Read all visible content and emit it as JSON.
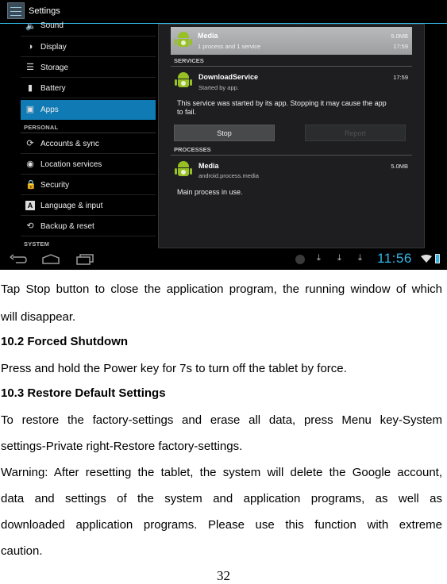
{
  "screenshot": {
    "app_title": "Settings",
    "accent_color": "#33b5e5",
    "sidebar": {
      "items_top": [
        {
          "label": "Sound",
          "icon": "sound-icon"
        },
        {
          "label": "Display",
          "icon": "display-icon"
        },
        {
          "label": "Storage",
          "icon": "storage-icon"
        },
        {
          "label": "Battery",
          "icon": "battery-icon"
        },
        {
          "label": "Apps",
          "icon": "apps-icon",
          "active": true
        }
      ],
      "section_personal": "PERSONAL",
      "items_personal": [
        {
          "label": "Accounts & sync",
          "icon": "sync-icon"
        },
        {
          "label": "Location services",
          "icon": "location-icon"
        },
        {
          "label": "Security",
          "icon": "lock-icon"
        },
        {
          "label": "Language & input",
          "icon": "language-icon"
        },
        {
          "label": "Backup & reset",
          "icon": "backup-icon"
        }
      ],
      "section_system": "SYSTEM"
    },
    "panel": {
      "app_row": {
        "title": "Media",
        "subtitle": "1 process and 1 service",
        "size": "5.0MB",
        "time": "17:59"
      },
      "services_label": "SERVICES",
      "service": {
        "title": "DownloadService",
        "subtitle": "Started by app.",
        "time": "17:59"
      },
      "service_desc_line1": "This service was started by its app. Stopping it may cause the app",
      "service_desc_line2": "to fail.",
      "stop_label": "Stop",
      "report_label": "Report",
      "processes_label": "PROCESSES",
      "process": {
        "title": "Media",
        "subtitle": "android.process.media",
        "size": "5.0MB"
      },
      "process_desc": "Main process in use."
    },
    "status_bar": {
      "time": "11:56"
    }
  },
  "document": {
    "para1_line1": "Tap Stop button to close the application program, the running window of which",
    "para1_line2": "will disappear.",
    "heading_10_2": "10.2 Forced Shutdown",
    "para2": "Press and hold the Power key for 7s to turn off the tablet by force.",
    "heading_10_3": "10.3 Restore Default Settings",
    "para3_line1": "To restore the factory-settings and erase all data, press Menu key-System",
    "para3_line2": "settings-Private right-Restore factory-settings.",
    "para4_line1": "Warning: After resetting the tablet, the system will delete the Google account,",
    "para4_line2": "data and settings of the system and application programs, as well as",
    "para4_line3": "downloaded application programs. Please use this function with extreme",
    "para4_line4": "caution.",
    "page_number": "32"
  }
}
